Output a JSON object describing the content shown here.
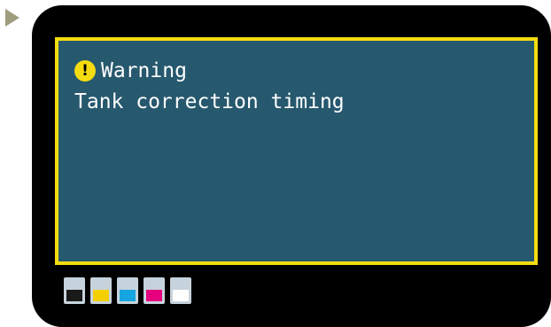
{
  "warning": {
    "title": "Warning",
    "icon": "exclamation-icon",
    "message": "Tank correction timing"
  },
  "colors": {
    "screen_bg": "#000000",
    "panel_bg": "#26586e",
    "panel_border": "#f5dc10",
    "warning_icon": "#f5dc10",
    "text": "#ffffff",
    "play_arrow": "#9e9d7e"
  },
  "ink_levels": [
    {
      "name": "black",
      "color": "#1a1a1a"
    },
    {
      "name": "yellow",
      "color": "#f5d000"
    },
    {
      "name": "cyan",
      "color": "#16a5e0"
    },
    {
      "name": "magenta",
      "color": "#e6007e"
    },
    {
      "name": "white",
      "color": "#ffffff"
    }
  ]
}
